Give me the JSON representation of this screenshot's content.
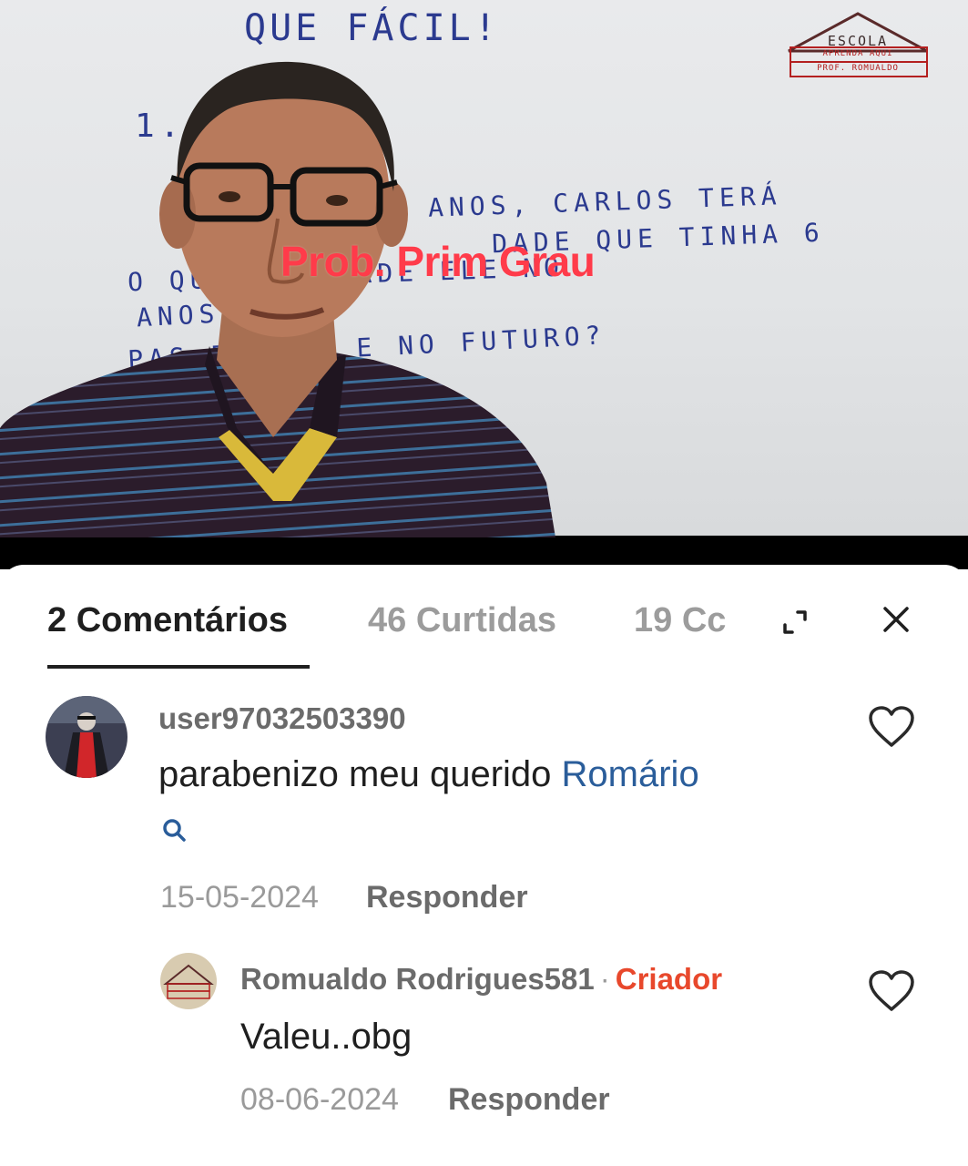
{
  "video": {
    "board_text": {
      "title": "QUE FÁCIL!",
      "number": "1.",
      "line1": "ANOS, CARLOS TERÁ",
      "line2": "DADE QUE TINHA 6",
      "line3": "O                QUAL A IDADE ELE NO",
      "line4": "ANOS",
      "line5": "PAS        ESENTE E NO FUTURO?"
    },
    "logo": {
      "line1": "ESCOLA",
      "line2": "APRENDA AQUI",
      "line3": "PROF. ROMUALDO"
    },
    "overlay_title": "Prob. Prim Grau"
  },
  "tabs": {
    "comments": "2 Comentários",
    "likes": "46 Curtidas",
    "third": "19 Cc"
  },
  "comments": [
    {
      "username": "user97032503390",
      "text": "parabenizo meu querido ",
      "mention": "Romário",
      "date": "15-05-2024",
      "reply_label": "Responder"
    },
    {
      "username": "Romualdo Rodrigues581",
      "separator": "·",
      "creator_tag": "Criador",
      "text": "Valeu..obg",
      "date": "08-06-2024",
      "reply_label": "Responder"
    }
  ],
  "icons": {
    "expand": "expand-icon",
    "close": "close-icon",
    "like": "heart-icon",
    "search": "search-icon"
  },
  "colors": {
    "overlay_text": "#ff3b4a",
    "mention": "#2a5d9a",
    "creator": "#e8482c",
    "marker": "#2b3a8f"
  }
}
